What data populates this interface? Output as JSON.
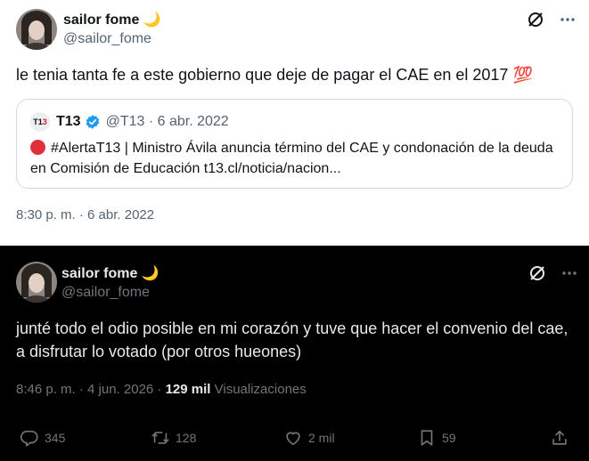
{
  "tweet1": {
    "name": "sailor fome",
    "name_emoji": "🌙",
    "handle": "@sailor_fome",
    "text": "le tenia tanta fe a este gobierno que deje de pagar el CAE en el 2017",
    "text_emoji": "💯",
    "quote": {
      "logo_text_black": "T1",
      "logo_text_red": "3",
      "name": "T13",
      "meta": "@T13 · 6 abr. 2022",
      "body": "#AlertaT13 | Ministro Ávila anuncia término del CAE y condonación de la deuda en Comisión de Educación t13.cl/noticia/nacion..."
    },
    "timestamp": "8:30 p. m. · 6 abr. 2022"
  },
  "tweet2": {
    "name": "sailor fome",
    "name_emoji": "🌙",
    "handle": "@sailor_fome",
    "text": "junté todo el odio posible en mi corazón y tuve que hacer el convenio del cae, a disfrutar lo votado (por otros hueones)",
    "timestamp_prefix": "8:46 p. m. · 4 jun. 2026 · ",
    "views_count": "129 mil",
    "views_label": " Visualizaciones",
    "actions": {
      "replies": "345",
      "retweets": "128",
      "likes": "2 mil",
      "bookmarks": "59"
    }
  },
  "icons": [
    "grok-icon",
    "more-icon",
    "verified-badge-icon",
    "reply-icon",
    "retweet-icon",
    "like-icon",
    "bookmark-icon",
    "share-icon"
  ],
  "colors": {
    "light_bg": "#ffffff",
    "dark_bg": "#000000",
    "verified_blue": "#1d9bf0",
    "alert_red": "#e0313a",
    "muted_light": "#536471",
    "muted_dark": "#71767b"
  }
}
